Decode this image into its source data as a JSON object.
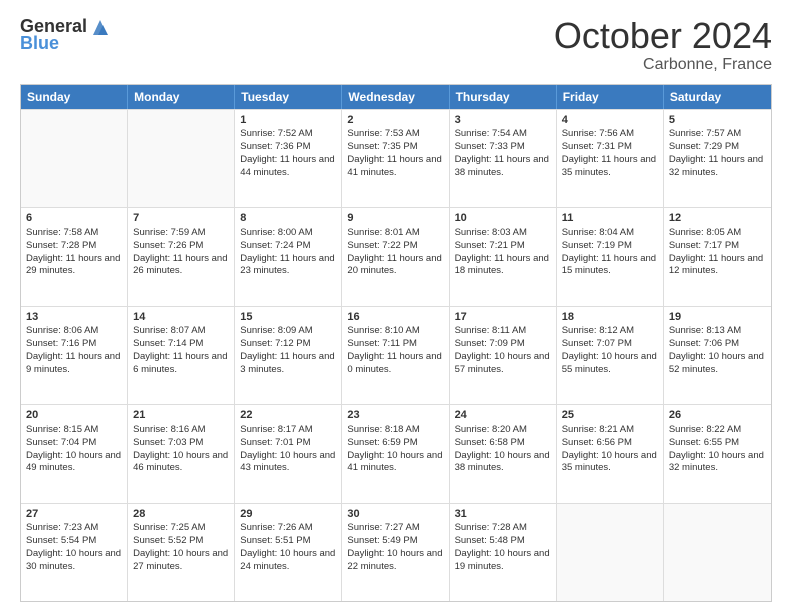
{
  "logo": {
    "general": "General",
    "blue": "Blue"
  },
  "header": {
    "month": "October 2024",
    "location": "Carbonne, France"
  },
  "days": [
    "Sunday",
    "Monday",
    "Tuesday",
    "Wednesday",
    "Thursday",
    "Friday",
    "Saturday"
  ],
  "rows": [
    [
      {
        "day": "",
        "empty": true
      },
      {
        "day": "",
        "empty": true
      },
      {
        "day": "1",
        "sunrise": "Sunrise: 7:52 AM",
        "sunset": "Sunset: 7:36 PM",
        "daylight": "Daylight: 11 hours and 44 minutes."
      },
      {
        "day": "2",
        "sunrise": "Sunrise: 7:53 AM",
        "sunset": "Sunset: 7:35 PM",
        "daylight": "Daylight: 11 hours and 41 minutes."
      },
      {
        "day": "3",
        "sunrise": "Sunrise: 7:54 AM",
        "sunset": "Sunset: 7:33 PM",
        "daylight": "Daylight: 11 hours and 38 minutes."
      },
      {
        "day": "4",
        "sunrise": "Sunrise: 7:56 AM",
        "sunset": "Sunset: 7:31 PM",
        "daylight": "Daylight: 11 hours and 35 minutes."
      },
      {
        "day": "5",
        "sunrise": "Sunrise: 7:57 AM",
        "sunset": "Sunset: 7:29 PM",
        "daylight": "Daylight: 11 hours and 32 minutes."
      }
    ],
    [
      {
        "day": "6",
        "sunrise": "Sunrise: 7:58 AM",
        "sunset": "Sunset: 7:28 PM",
        "daylight": "Daylight: 11 hours and 29 minutes."
      },
      {
        "day": "7",
        "sunrise": "Sunrise: 7:59 AM",
        "sunset": "Sunset: 7:26 PM",
        "daylight": "Daylight: 11 hours and 26 minutes."
      },
      {
        "day": "8",
        "sunrise": "Sunrise: 8:00 AM",
        "sunset": "Sunset: 7:24 PM",
        "daylight": "Daylight: 11 hours and 23 minutes."
      },
      {
        "day": "9",
        "sunrise": "Sunrise: 8:01 AM",
        "sunset": "Sunset: 7:22 PM",
        "daylight": "Daylight: 11 hours and 20 minutes."
      },
      {
        "day": "10",
        "sunrise": "Sunrise: 8:03 AM",
        "sunset": "Sunset: 7:21 PM",
        "daylight": "Daylight: 11 hours and 18 minutes."
      },
      {
        "day": "11",
        "sunrise": "Sunrise: 8:04 AM",
        "sunset": "Sunset: 7:19 PM",
        "daylight": "Daylight: 11 hours and 15 minutes."
      },
      {
        "day": "12",
        "sunrise": "Sunrise: 8:05 AM",
        "sunset": "Sunset: 7:17 PM",
        "daylight": "Daylight: 11 hours and 12 minutes."
      }
    ],
    [
      {
        "day": "13",
        "sunrise": "Sunrise: 8:06 AM",
        "sunset": "Sunset: 7:16 PM",
        "daylight": "Daylight: 11 hours and 9 minutes."
      },
      {
        "day": "14",
        "sunrise": "Sunrise: 8:07 AM",
        "sunset": "Sunset: 7:14 PM",
        "daylight": "Daylight: 11 hours and 6 minutes."
      },
      {
        "day": "15",
        "sunrise": "Sunrise: 8:09 AM",
        "sunset": "Sunset: 7:12 PM",
        "daylight": "Daylight: 11 hours and 3 minutes."
      },
      {
        "day": "16",
        "sunrise": "Sunrise: 8:10 AM",
        "sunset": "Sunset: 7:11 PM",
        "daylight": "Daylight: 11 hours and 0 minutes."
      },
      {
        "day": "17",
        "sunrise": "Sunrise: 8:11 AM",
        "sunset": "Sunset: 7:09 PM",
        "daylight": "Daylight: 10 hours and 57 minutes."
      },
      {
        "day": "18",
        "sunrise": "Sunrise: 8:12 AM",
        "sunset": "Sunset: 7:07 PM",
        "daylight": "Daylight: 10 hours and 55 minutes."
      },
      {
        "day": "19",
        "sunrise": "Sunrise: 8:13 AM",
        "sunset": "Sunset: 7:06 PM",
        "daylight": "Daylight: 10 hours and 52 minutes."
      }
    ],
    [
      {
        "day": "20",
        "sunrise": "Sunrise: 8:15 AM",
        "sunset": "Sunset: 7:04 PM",
        "daylight": "Daylight: 10 hours and 49 minutes."
      },
      {
        "day": "21",
        "sunrise": "Sunrise: 8:16 AM",
        "sunset": "Sunset: 7:03 PM",
        "daylight": "Daylight: 10 hours and 46 minutes."
      },
      {
        "day": "22",
        "sunrise": "Sunrise: 8:17 AM",
        "sunset": "Sunset: 7:01 PM",
        "daylight": "Daylight: 10 hours and 43 minutes."
      },
      {
        "day": "23",
        "sunrise": "Sunrise: 8:18 AM",
        "sunset": "Sunset: 6:59 PM",
        "daylight": "Daylight: 10 hours and 41 minutes."
      },
      {
        "day": "24",
        "sunrise": "Sunrise: 8:20 AM",
        "sunset": "Sunset: 6:58 PM",
        "daylight": "Daylight: 10 hours and 38 minutes."
      },
      {
        "day": "25",
        "sunrise": "Sunrise: 8:21 AM",
        "sunset": "Sunset: 6:56 PM",
        "daylight": "Daylight: 10 hours and 35 minutes."
      },
      {
        "day": "26",
        "sunrise": "Sunrise: 8:22 AM",
        "sunset": "Sunset: 6:55 PM",
        "daylight": "Daylight: 10 hours and 32 minutes."
      }
    ],
    [
      {
        "day": "27",
        "sunrise": "Sunrise: 7:23 AM",
        "sunset": "Sunset: 5:54 PM",
        "daylight": "Daylight: 10 hours and 30 minutes."
      },
      {
        "day": "28",
        "sunrise": "Sunrise: 7:25 AM",
        "sunset": "Sunset: 5:52 PM",
        "daylight": "Daylight: 10 hours and 27 minutes."
      },
      {
        "day": "29",
        "sunrise": "Sunrise: 7:26 AM",
        "sunset": "Sunset: 5:51 PM",
        "daylight": "Daylight: 10 hours and 24 minutes."
      },
      {
        "day": "30",
        "sunrise": "Sunrise: 7:27 AM",
        "sunset": "Sunset: 5:49 PM",
        "daylight": "Daylight: 10 hours and 22 minutes."
      },
      {
        "day": "31",
        "sunrise": "Sunrise: 7:28 AM",
        "sunset": "Sunset: 5:48 PM",
        "daylight": "Daylight: 10 hours and 19 minutes."
      },
      {
        "day": "",
        "empty": true
      },
      {
        "day": "",
        "empty": true
      }
    ]
  ]
}
